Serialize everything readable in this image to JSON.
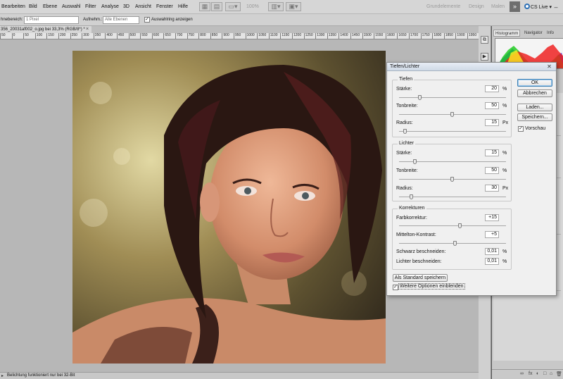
{
  "menu": [
    "Bearbeiten",
    "Bild",
    "Ebene",
    "Auswahl",
    "Filter",
    "Analyse",
    "3D",
    "Ansicht",
    "Fenster",
    "Hilfe"
  ],
  "appbar": {
    "zoom": "100%",
    "workspaces": [
      "Grundelemente",
      "Design",
      "Malen"
    ],
    "more": "»",
    "cs_live": "CS Live",
    "cs_live_arrow": "▾",
    "win_buttons": [
      "–",
      "□",
      "✕"
    ]
  },
  "options": {
    "sample_size_label": "hnebereich:",
    "sample_size_value": "1 Pixel",
    "sample_label": "Aufnehm.:",
    "sample_value": "Alle Ebenen",
    "show_ring_checked": "✓",
    "show_ring_label": "Auswahlring anzeigen"
  },
  "document": {
    "tab_title": "356_20031af002_o.jpg bei 33,3% (RGB/8*) *",
    "tab_close": "×",
    "ruler_ticks": [
      "50",
      "0",
      "50",
      "100",
      "150",
      "200",
      "250",
      "300",
      "350",
      "400",
      "450",
      "500",
      "550",
      "600",
      "650",
      "700",
      "750",
      "800",
      "850",
      "900",
      "950",
      "1000",
      "1050",
      "1100",
      "1150",
      "1200",
      "1250",
      "1300",
      "1350",
      "1400",
      "1450",
      "1500",
      "1550",
      "1600",
      "1650",
      "1700",
      "1750",
      "1800",
      "1850",
      "1900",
      "1950"
    ]
  },
  "status": {
    "text": "Belichtung funktioniert nur bei 32-Bit",
    "arrow": "▸"
  },
  "panel": {
    "tabs": [
      "Histogramm",
      "Navigator",
      "Info"
    ],
    "bottom_icons": [
      "∞",
      "fx",
      "◐",
      "□",
      "⌂",
      "🗑"
    ]
  },
  "dialog": {
    "title": "Tiefen/Lichter",
    "close": "✕",
    "tiefen": {
      "legend": "Tiefen",
      "fields": [
        {
          "label": "Stärke:",
          "value": "20",
          "unit": "%",
          "slider": 0.2
        },
        {
          "label": "Tonbreite:",
          "value": "50",
          "unit": "%",
          "slider": 0.5
        },
        {
          "label": "Radius:",
          "value": "15",
          "unit": "Px",
          "slider": 0.06
        }
      ]
    },
    "lichter": {
      "legend": "Lichter",
      "fields": [
        {
          "label": "Stärke:",
          "value": "15",
          "unit": "%",
          "slider": 0.15
        },
        {
          "label": "Tonbreite:",
          "value": "50",
          "unit": "%",
          "slider": 0.5
        },
        {
          "label": "Radius:",
          "value": "30",
          "unit": "Px",
          "slider": 0.12
        }
      ]
    },
    "korrekturen": {
      "legend": "Korrekturen",
      "farb_label": "Farbkorrektur:",
      "farb_value": "+15",
      "farb_slider": 0.575,
      "mittel_label": "Mittelton-Kontrast:",
      "mittel_value": "+5",
      "mittel_slider": 0.525,
      "schwarz_label": "Schwarz beschneiden:",
      "schwarz_value": "0,01",
      "schwarz_unit": "%",
      "lichter_label": "Lichter beschneiden:",
      "lichter_value": "0,01",
      "lichter_unit": "%"
    },
    "buttons": {
      "ok": "OK",
      "cancel": "Abbrechen",
      "load": "Laden...",
      "save": "Speichern...",
      "preview_label": "Vorschau",
      "preview_checked": "✓",
      "save_default": "Als Standard speichern",
      "more_options_label": "Weitere Optionen einblenden",
      "more_options_checked": "✓"
    }
  }
}
